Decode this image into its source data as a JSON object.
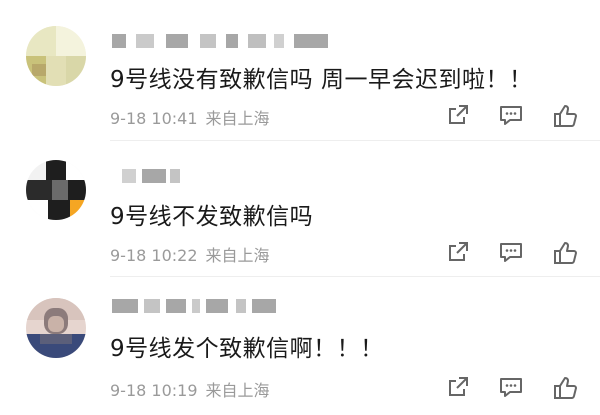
{
  "comments": [
    {
      "text": "9号线没有致歉信吗  周一早会迟到啦！！",
      "time": "9-18 10:41",
      "location": "来自上海",
      "avatar_colors": [
        "#e8e7c2",
        "#d9d7a8",
        "#c9c27a",
        "#f1efd9",
        "#b8a86a",
        "#e2dfb5"
      ]
    },
    {
      "text": "9号线不发致歉信吗",
      "time": "9-18 10:22",
      "location": "来自上海",
      "avatar_colors": [
        "#1e1e1e",
        "#f2f2f2",
        "#6b6b6b",
        "#f5a623",
        "#ffffff",
        "#2b2b2b"
      ]
    },
    {
      "text": "9号线发个致歉信啊！！！",
      "time": "9-18 10:19",
      "location": "来自上海",
      "avatar_colors": [
        "#8c7b7b",
        "#c9b2a8",
        "#3a4a7a",
        "#e6d5cf",
        "#5b5f7a",
        "#d8c4bd"
      ]
    }
  ],
  "actions": {
    "share_icon": "share-icon",
    "comment_icon": "comment-icon",
    "like_icon": "like-icon"
  },
  "colors": {
    "text": "#1a1a1a",
    "meta": "#9a9a9a",
    "icon": "#666666",
    "username_blur": "#8a8a8a"
  }
}
